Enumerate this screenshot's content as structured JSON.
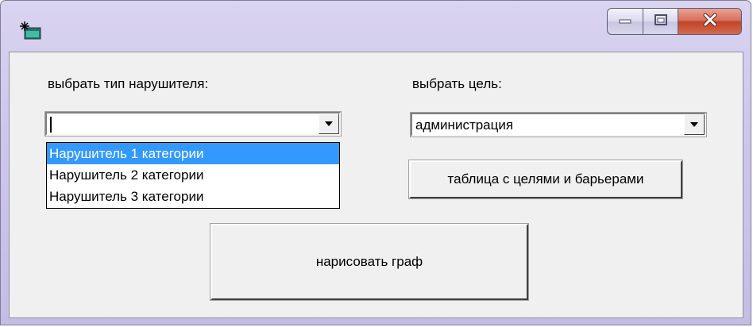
{
  "window": {
    "icon": "app-icon",
    "controls": {
      "minimize_icon": "minimize-icon",
      "maximize_icon": "maximize-icon",
      "close_icon": "close-icon"
    }
  },
  "intruder": {
    "label": "выбрать тип нарушителя:",
    "value": "",
    "options": [
      "Нарушитель 1 категории",
      "Нарушитель 2 категории",
      "Нарушитель 3 категории"
    ],
    "highlighted_index": 0
  },
  "target": {
    "label": "выбрать цель:",
    "value": "администрация"
  },
  "buttons": {
    "table": "таблица с целями и барьерами",
    "draw": "нарисовать граф"
  },
  "colors": {
    "selection": "#3399ff",
    "close_button": "#c9472f",
    "client_bg": "#f0f0f0"
  }
}
